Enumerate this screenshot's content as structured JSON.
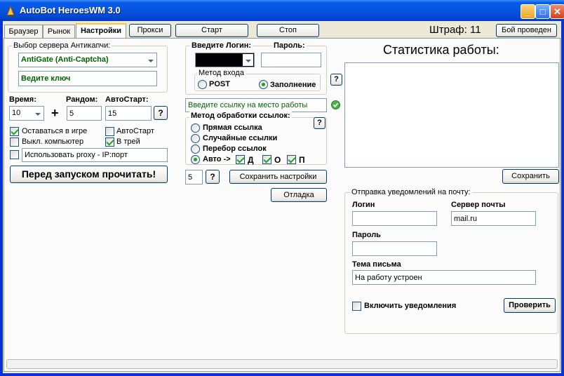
{
  "window": {
    "title": "AutoBot HeroesWM 3.0"
  },
  "tabs": [
    {
      "label": "Браузер"
    },
    {
      "label": "Рынок"
    },
    {
      "label": "Настройки"
    }
  ],
  "toolbar": {
    "proxy_label": "Прокси",
    "start_label": "Старт",
    "stop_label": "Стоп",
    "penalty_label": "Штраф: 11",
    "fight_done_label": "Бой проведен"
  },
  "captcha": {
    "legend": "Выбор сервера Антикапчи:",
    "server": "AntiGate (Anti-Captcha)",
    "key_placeholder": "Ведите ключ"
  },
  "timing": {
    "time_label": "Время:",
    "time_value": "10",
    "random_label": "Рандом:",
    "random_value": "5",
    "autostart_label": "АвтоСтарт:",
    "autostart_value": "15",
    "help": "?"
  },
  "options": {
    "stay_in_game": "Оставаться в игре",
    "autostart": "АвтоСтарт",
    "shutdown": "Выкл. компьютер",
    "to_tray": "В трей",
    "proxy": "Использовать proxy - IP:порт"
  },
  "read_before_button": "Перед запуском прочитать!",
  "login": {
    "login_label": "Введите Логин:",
    "password_label": "Пароль:",
    "method_legend": "Метод входа",
    "post_label": "POST",
    "fill_label": "Заполнение",
    "help": "?"
  },
  "work_link": {
    "placeholder": "Введите ссылку на место работы"
  },
  "link_method": {
    "legend": "Метод обработки ссылок:",
    "direct": "Прямая ссылка",
    "random": "Случайные ссылки",
    "enumerate": "Перебор ссылок",
    "auto": "Авто ->",
    "d": "Д",
    "o": "О",
    "p": "П",
    "help": "?"
  },
  "save_settings": {
    "count_value": "5",
    "help": "?",
    "save_label": "Сохранить настройки",
    "debug_label": "Отладка"
  },
  "stats": {
    "title": "Статистика работы:",
    "save_label": "Сохранить"
  },
  "email": {
    "legend": "Отправка уведомлений на почту:",
    "login_label": "Логин",
    "login_value": "",
    "server_label": "Сервер почты",
    "server_value": "mail.ru",
    "password_label": "Пароль",
    "password_value": "",
    "subject_label": "Тема письма",
    "subject_value": "На работу устроен",
    "enable_label": "Включить уведомления",
    "check_label": "Проверить"
  },
  "colors": {
    "titlebar": "#0655e2",
    "client_bg": "#ece9d8",
    "green_text": "#006400",
    "check_green": "#21a121"
  }
}
